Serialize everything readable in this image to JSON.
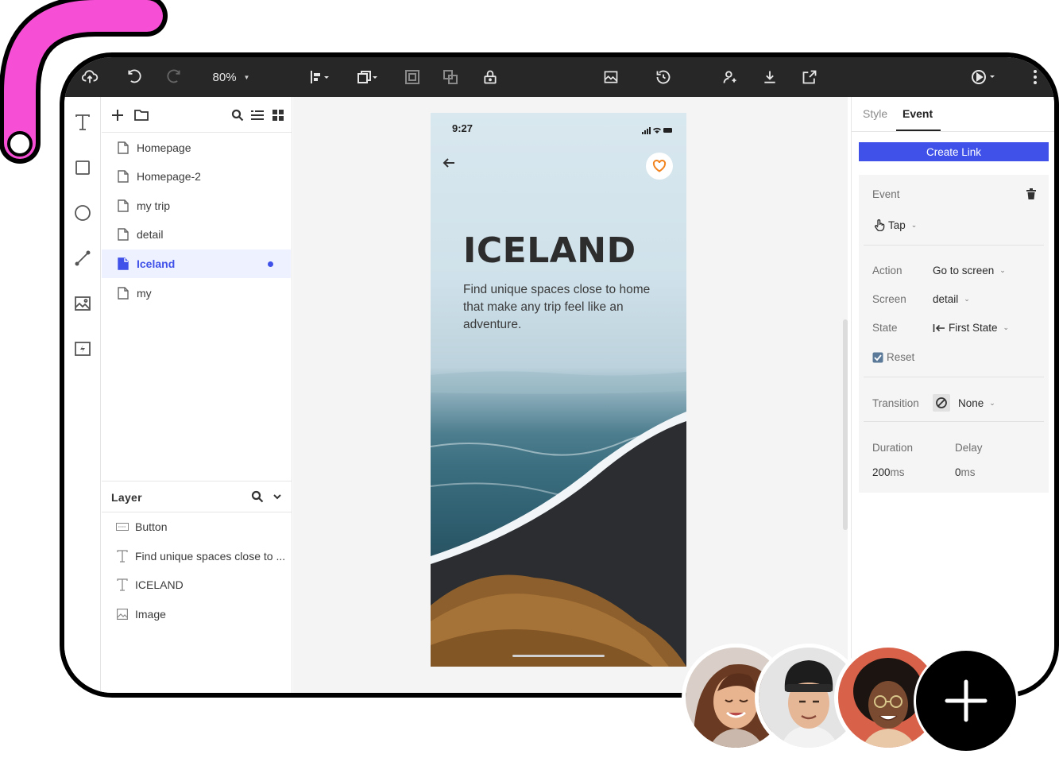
{
  "toolbar": {
    "zoom_label": "80%"
  },
  "pages": {
    "items": [
      {
        "label": "Homepage",
        "active": false
      },
      {
        "label": "Homepage-2",
        "active": false
      },
      {
        "label": "my trip",
        "active": false
      },
      {
        "label": "detail",
        "active": false
      },
      {
        "label": "Iceland",
        "active": true
      },
      {
        "label": "my",
        "active": false
      }
    ]
  },
  "layers": {
    "title": "Layer",
    "items": [
      {
        "label": "Button",
        "icon": "button-icon"
      },
      {
        "label": "Find unique spaces close to ...",
        "icon": "text-icon"
      },
      {
        "label": "ICELAND",
        "icon": "text-icon"
      },
      {
        "label": "Image",
        "icon": "image-icon"
      }
    ]
  },
  "phone": {
    "time": "9:27",
    "title": "ICELAND",
    "description": "Find unique spaces close to home that make any trip feel like an adventure."
  },
  "inspector": {
    "tabs": [
      "Style",
      "Event"
    ],
    "active_tab": "Event",
    "create_link_label": "Create Link",
    "event_label": "Event",
    "event_value": "Tap",
    "action_label": "Action",
    "action_value": "Go to screen",
    "screen_label": "Screen",
    "screen_value": "detail",
    "state_label": "State",
    "state_value": "First State",
    "reset_label": "Reset",
    "transition_label": "Transition",
    "transition_value": "None",
    "duration_label": "Duration",
    "duration_value": "200",
    "duration_unit": "ms",
    "delay_label": "Delay",
    "delay_value": "0",
    "delay_unit": "ms"
  },
  "colors": {
    "accent": "#3f51e8",
    "hook": "#f64fd6",
    "toolbar_bg": "#272727"
  }
}
